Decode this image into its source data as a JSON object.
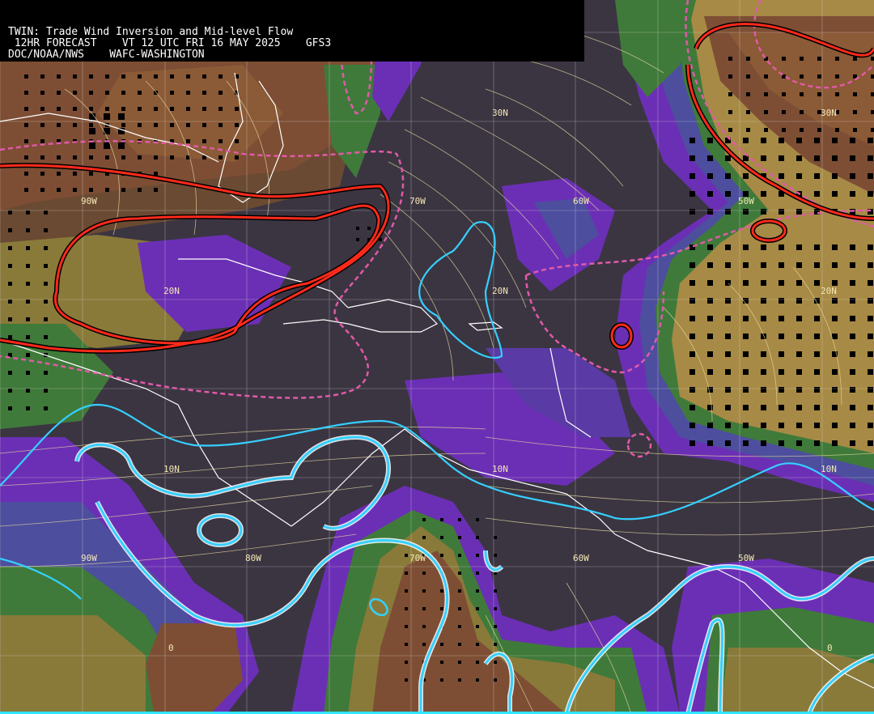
{
  "header": {
    "line1": "TWIN: Trade Wind Inversion and Mid-level Flow",
    "line2": " 12HR FORECAST    VT 12 UTC FRI 16 MAY 2025    GFS3",
    "line3": "DOC/NOAA/NWS    WAFC-WASHINGTON"
  },
  "colors": {
    "background_dark": "#3b3542",
    "purple": "#6b2fb5",
    "blue_band": "#4d4e9e",
    "green_band": "#3f7a3a",
    "olive": "#8a7a3a",
    "brown": "#7a4a2e",
    "tan": "#a78a45",
    "red_contour": "#ff2a1a",
    "magenta_dashed": "#e05aa8",
    "cyan_contour": "#35d0ff",
    "streamline": "#e8dca0",
    "coastline": "#ffffff",
    "bottom_bar": "#33e5ff"
  },
  "graticule_labels": {
    "lat_30n_a": "30N",
    "lat_30n_b": "30N",
    "lon_90w_top": "90W",
    "lon_70w_top": "70W",
    "lon_60w_top": "60W",
    "lon_50w_top": "50W",
    "lat_20n_a": "20N",
    "lat_20n_b": "20N",
    "lat_20n_c": "20N",
    "lat_10n_a": "10N",
    "lat_10n_b": "10N",
    "lat_10n_c": "10N",
    "lon_90w_bot": "90W",
    "lon_80w_bot": "80W",
    "lon_70w_bot": "70W",
    "lon_60w_bot": "60W",
    "lon_50w_bot": "50W",
    "eq_a": "0",
    "eq_b": "0"
  }
}
